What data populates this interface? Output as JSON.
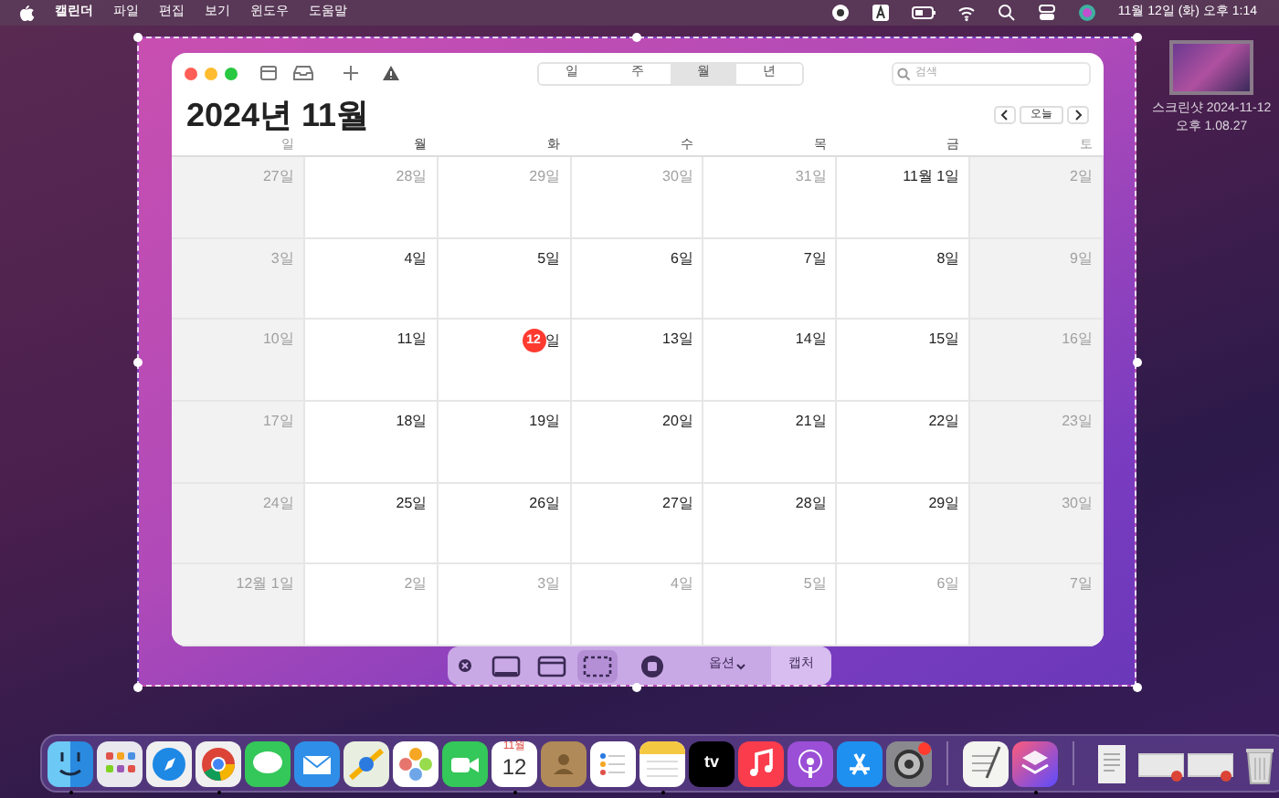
{
  "menu_bar": {
    "items": [
      "캘린더",
      "파일",
      "편집",
      "보기",
      "윈도우",
      "도움말"
    ],
    "clock": "11월 12일 (화) 오후 1:14"
  },
  "desktop_file": {
    "name_lines": [
      "스크린샷 2024-11-12",
      "오후 1.08.27"
    ]
  },
  "calendar": {
    "views": [
      {
        "label": "일",
        "selected": false
      },
      {
        "label": "주",
        "selected": false
      },
      {
        "label": "월",
        "selected": true
      },
      {
        "label": "년",
        "selected": false
      }
    ],
    "search": {
      "placeholder": "검색"
    },
    "title": "2024년 11월",
    "today_button": "오늘",
    "weekdays": [
      {
        "label": "일",
        "weekend": true
      },
      {
        "label": "월",
        "weekend": false
      },
      {
        "label": "화",
        "weekend": false
      },
      {
        "label": "수",
        "weekend": false
      },
      {
        "label": "목",
        "weekend": false
      },
      {
        "label": "금",
        "weekend": false
      },
      {
        "label": "토",
        "weekend": true
      }
    ],
    "weeks": [
      [
        {
          "label": "27일",
          "muted": true,
          "today": false
        },
        {
          "label": "28일",
          "muted": true,
          "today": false
        },
        {
          "label": "29일",
          "muted": true,
          "today": false
        },
        {
          "label": "30일",
          "muted": true,
          "today": false
        },
        {
          "label": "31일",
          "muted": true,
          "today": false
        },
        {
          "label": "11월 1일",
          "muted": false,
          "today": false
        },
        {
          "label": "2일",
          "muted": true,
          "today": false
        }
      ],
      [
        {
          "label": "3일",
          "muted": true,
          "today": false
        },
        {
          "label": "4일",
          "muted": false,
          "today": false
        },
        {
          "label": "5일",
          "muted": false,
          "today": false
        },
        {
          "label": "6일",
          "muted": false,
          "today": false
        },
        {
          "label": "7일",
          "muted": false,
          "today": false
        },
        {
          "label": "8일",
          "muted": false,
          "today": false
        },
        {
          "label": "9일",
          "muted": true,
          "today": false
        }
      ],
      [
        {
          "label": "10일",
          "muted": true,
          "today": false
        },
        {
          "label": "11일",
          "muted": false,
          "today": false
        },
        {
          "label": "일",
          "badge": "12",
          "muted": false,
          "today": true
        },
        {
          "label": "13일",
          "muted": false,
          "today": false
        },
        {
          "label": "14일",
          "muted": false,
          "today": false
        },
        {
          "label": "15일",
          "muted": false,
          "today": false
        },
        {
          "label": "16일",
          "muted": true,
          "today": false
        }
      ],
      [
        {
          "label": "17일",
          "muted": true,
          "today": false
        },
        {
          "label": "18일",
          "muted": false,
          "today": false
        },
        {
          "label": "19일",
          "muted": false,
          "today": false
        },
        {
          "label": "20일",
          "muted": false,
          "today": false
        },
        {
          "label": "21일",
          "muted": false,
          "today": false
        },
        {
          "label": "22일",
          "muted": false,
          "today": false
        },
        {
          "label": "23일",
          "muted": true,
          "today": false
        }
      ],
      [
        {
          "label": "24일",
          "muted": true,
          "today": false
        },
        {
          "label": "25일",
          "muted": false,
          "today": false
        },
        {
          "label": "26일",
          "muted": false,
          "today": false
        },
        {
          "label": "27일",
          "muted": false,
          "today": false
        },
        {
          "label": "28일",
          "muted": false,
          "today": false
        },
        {
          "label": "29일",
          "muted": false,
          "today": false
        },
        {
          "label": "30일",
          "muted": true,
          "today": false
        }
      ],
      [
        {
          "label": "12월 1일",
          "muted": true,
          "today": false
        },
        {
          "label": "2일",
          "muted": true,
          "today": false
        },
        {
          "label": "3일",
          "muted": true,
          "today": false
        },
        {
          "label": "4일",
          "muted": true,
          "today": false
        },
        {
          "label": "5일",
          "muted": true,
          "today": false
        },
        {
          "label": "6일",
          "muted": true,
          "today": false
        },
        {
          "label": "7일",
          "muted": true,
          "today": false
        }
      ]
    ]
  },
  "capture_toolbar": {
    "modes": [
      {
        "kind": "screen",
        "selected": false
      },
      {
        "kind": "window",
        "selected": false
      },
      {
        "kind": "selection",
        "selected": true
      },
      {
        "kind": "record",
        "selected": false
      }
    ],
    "options": "옵션",
    "capture": "캡처"
  },
  "dock": {
    "items": [
      {
        "kind": "finder",
        "running": true
      },
      {
        "kind": "launchpad",
        "running": false
      },
      {
        "kind": "safari",
        "running": false
      },
      {
        "kind": "chrome",
        "running": true
      },
      {
        "kind": "messages",
        "running": false
      },
      {
        "kind": "mail",
        "running": false
      },
      {
        "kind": "maps",
        "running": false
      },
      {
        "kind": "photos",
        "running": false
      },
      {
        "kind": "facetime",
        "running": false
      },
      {
        "kind": "calendar",
        "running": true,
        "month": "11월",
        "day": "12"
      },
      {
        "kind": "contacts",
        "running": false
      },
      {
        "kind": "reminders",
        "running": false
      },
      {
        "kind": "notes",
        "running": true
      },
      {
        "kind": "tv",
        "running": false,
        "text": "tv"
      },
      {
        "kind": "music",
        "running": false
      },
      {
        "kind": "podcasts",
        "running": false
      },
      {
        "kind": "appstore",
        "running": false
      },
      {
        "kind": "settings",
        "running": false
      },
      {
        "kind": "separator"
      },
      {
        "kind": "textedit",
        "running": false
      },
      {
        "kind": "shortcuts",
        "running": true
      },
      {
        "kind": "separator"
      },
      {
        "kind": "document"
      },
      {
        "kind": "thumbnail"
      },
      {
        "kind": "thumbnail"
      },
      {
        "kind": "trash"
      }
    ]
  }
}
